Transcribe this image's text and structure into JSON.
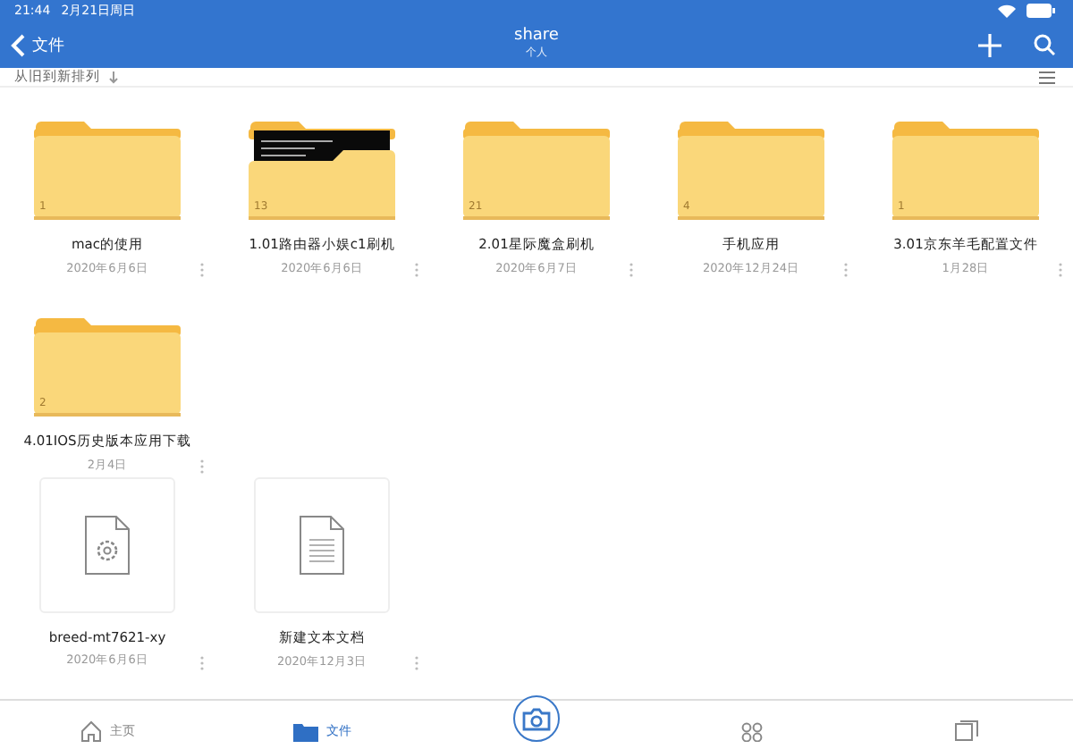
{
  "status_bar": {
    "time": "21:44",
    "date": "2月21日周日"
  },
  "nav": {
    "back_label": "文件",
    "title": "share",
    "subtitle": "个人"
  },
  "sort": {
    "label": "从旧到新排列"
  },
  "items": [
    {
      "kind": "folder",
      "name": "mac的使用",
      "date": "2020年6月6日",
      "count": "1"
    },
    {
      "kind": "folder-preview",
      "name": "1.01路由器小娱c1刷机",
      "date": "2020年6月6日",
      "count": "13"
    },
    {
      "kind": "folder",
      "name": "2.01星际魔盒刷机",
      "date": "2020年6月7日",
      "count": "21"
    },
    {
      "kind": "folder",
      "name": "手机应用",
      "date": "2020年12月24日",
      "count": "4"
    },
    {
      "kind": "folder",
      "name": "3.01京东羊毛配置文件",
      "date": "1月28日",
      "count": "1"
    },
    {
      "kind": "folder",
      "name": "4.01IOS历史版本应用下载",
      "date": "2月4日",
      "count": "2"
    },
    {
      "kind": "settings-file",
      "name": "breed-mt7621-xy",
      "date": "2020年6月6日"
    },
    {
      "kind": "text-file",
      "name": "新建文本文档",
      "date": "2020年12月3日"
    }
  ],
  "tab_bar": {
    "tabs": [
      {
        "kind": "home",
        "label": "主页",
        "selected": false
      },
      {
        "kind": "files",
        "label": "文件",
        "selected": true
      },
      {
        "kind": "camera",
        "selected": false
      },
      {
        "kind": "shared",
        "selected": false
      },
      {
        "kind": "recent",
        "selected": false
      }
    ]
  }
}
